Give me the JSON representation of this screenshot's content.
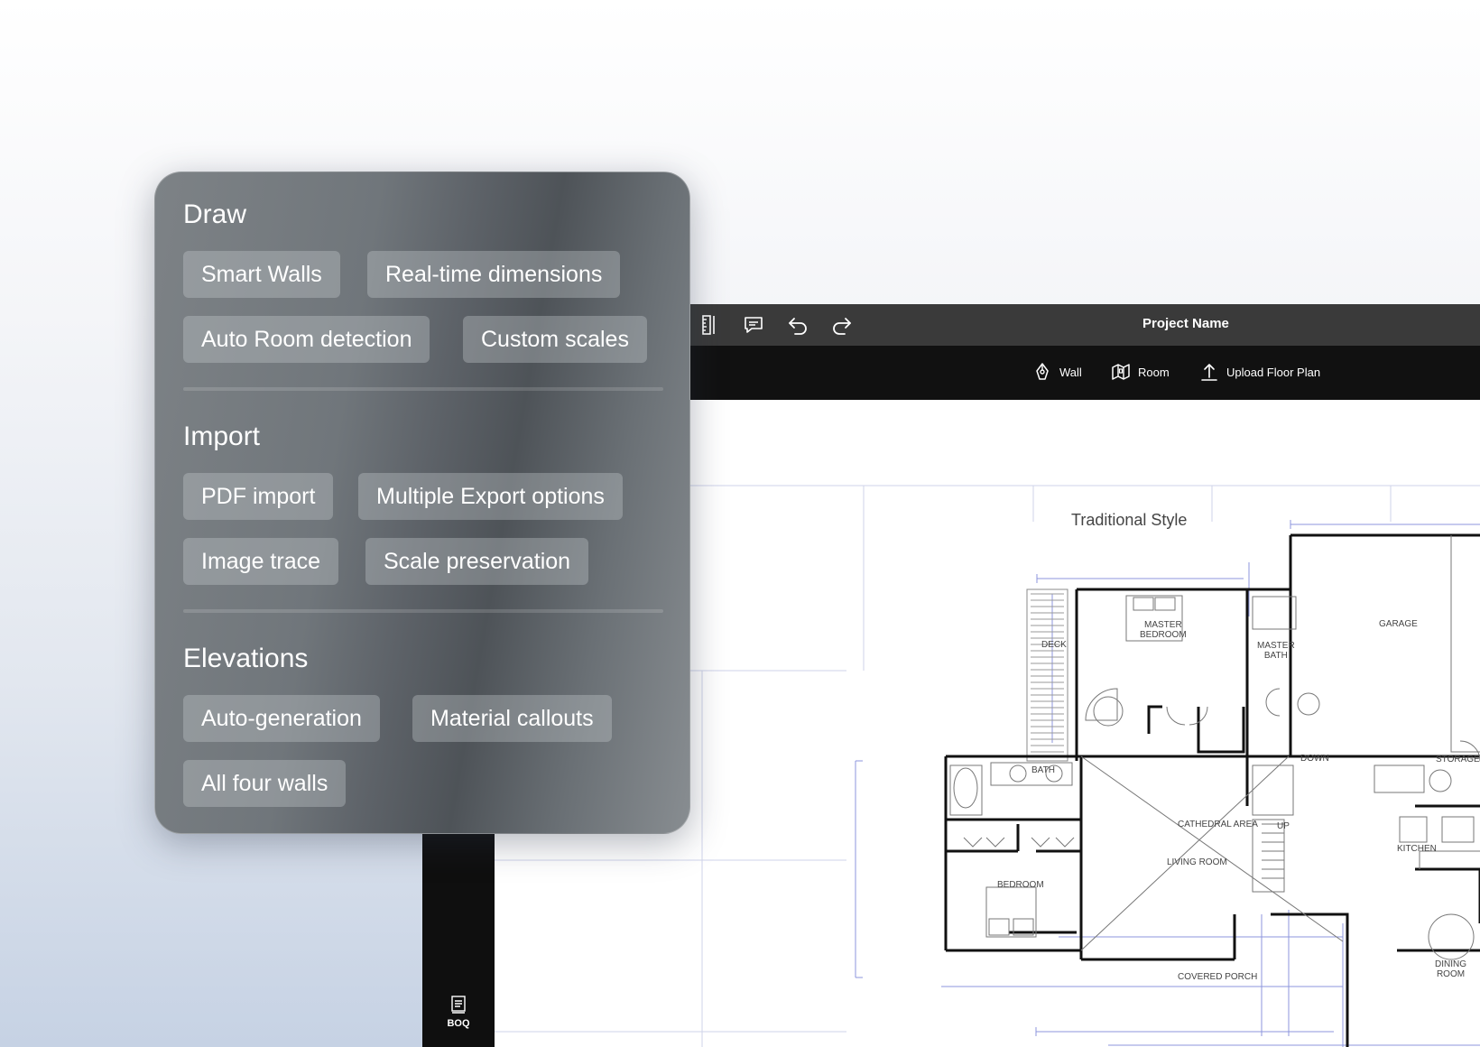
{
  "panel": {
    "sections": [
      {
        "title": "Draw",
        "chips": [
          "Smart Walls",
          "Real-time dimensions",
          "Auto Room detection",
          "Custom scales"
        ]
      },
      {
        "title": "Import",
        "chips": [
          "PDF import",
          "Multiple Export options",
          "Image trace",
          "Scale preservation"
        ]
      },
      {
        "title": "Elevations",
        "chips": [
          "Auto-generation",
          "Material callouts",
          "All four walls"
        ]
      }
    ]
  },
  "app": {
    "title": "Project Name",
    "titlebar_icons": [
      "ruler-icon",
      "comment-icon",
      "undo-icon",
      "redo-icon"
    ],
    "toolbar": {
      "wall": "Wall",
      "room": "Room",
      "upload": "Upload Floor Plan"
    },
    "sidebar": {
      "boq": "BOQ"
    }
  },
  "floor_plan": {
    "title": "Traditional Style",
    "rooms": [
      "MASTER\nBEDROOM",
      "MASTER\nBATH",
      "GARAGE",
      "DECK",
      "BATH",
      "DOWN",
      "STORAGE",
      "CATHEDRAL AREA",
      "UP",
      "KITCHEN",
      "LIVING ROOM",
      "BEDROOM",
      "DINING ROOM",
      "COVERED PORCH"
    ]
  },
  "colors": {
    "titlebar": "#3a3a3a",
    "toolbar": "#111111",
    "accent_dimension": "#7b86d6"
  }
}
